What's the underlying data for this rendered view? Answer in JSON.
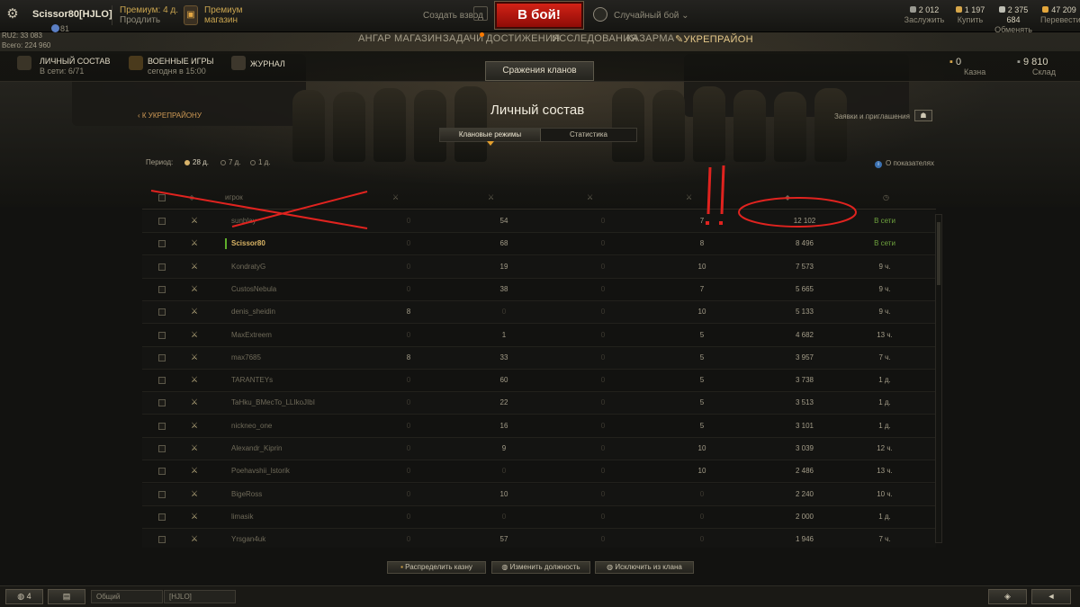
{
  "topbar": {
    "player_name": "Scissor80[HJLO]",
    "level": "81",
    "ratings": [
      "RU2: 33 083",
      "Всего: 224 960"
    ],
    "premium_label": "Премиум: 4 д.",
    "premium_extend": "Продлить",
    "shop_line1": "Премиум",
    "shop_line2": "магазин",
    "create_platoon": "Создать взвод",
    "battle_button": "В бой!",
    "battle_mode": "Случайный бой",
    "resources": [
      {
        "value": "2 012",
        "label": "Заслужить",
        "color": "#9a9a92"
      },
      {
        "value": "1 197",
        "label": "Купить",
        "color": "#d6a64a"
      },
      {
        "value": "2 375 684",
        "label": "Обменять",
        "color": "#bdbdb3"
      },
      {
        "value": "47 209",
        "label": "Перевести",
        "color": "#e3a63c"
      }
    ]
  },
  "nav": {
    "items": [
      "АНГАР",
      "МАГАЗИН",
      "ЗАДАЧИ",
      "ДОСТИЖЕНИЯ",
      "ИССЛЕДОВАНИЯ",
      "КАЗАРМА",
      "УКРЕПРАЙОН"
    ],
    "active": "УКРЕПРАЙОН"
  },
  "subnav": {
    "personnel_title": "ЛИЧНЫЙ СОСТАВ",
    "personnel_sub": "В сети: 6/71",
    "wargames_title": "ВОЕННЫЕ ИГРЫ",
    "wargames_sub": "сегодня в 15:00",
    "journal_title": "ЖУРНАЛ",
    "clan_battles": "Сражения кланов",
    "treasury_value": "0",
    "treasury_label": "Казна",
    "warehouse_value": "9 810",
    "warehouse_label": "Склад"
  },
  "page": {
    "back_link": "К УКРЕПРАЙОНУ",
    "title": "Личный состав",
    "tabs": [
      "Клановые режимы",
      "Статистика"
    ],
    "applications": "Заявки и приглашения",
    "period_label": "Период:",
    "periods": [
      "28 д.",
      "7 д.",
      "1 д."
    ],
    "period_selected": "28 д.",
    "info_link": "О показателях"
  },
  "table": {
    "header_player": "игрок",
    "rows": [
      {
        "name": "sunblay",
        "c1": "0",
        "c2": "54",
        "c3": "0",
        "c4": "7",
        "c5": "12 102",
        "status": "В сети",
        "online": true,
        "rank": "⚔",
        "me": false
      },
      {
        "name": "Scissor80",
        "c1": "0",
        "c2": "68",
        "c3": "0",
        "c4": "8",
        "c5": "8 496",
        "status": "В сети",
        "online": true,
        "rank": "⚔",
        "me": true
      },
      {
        "name": "KondratyG",
        "c1": "0",
        "c2": "19",
        "c3": "0",
        "c4": "10",
        "c5": "7 573",
        "status": "9 ч.",
        "online": false,
        "rank": "⚔",
        "me": false
      },
      {
        "name": "CustosNebula",
        "c1": "0",
        "c2": "38",
        "c3": "0",
        "c4": "7",
        "c5": "5 665",
        "status": "9 ч.",
        "online": false,
        "rank": "⚔",
        "me": false
      },
      {
        "name": "denis_sheidin",
        "c1": "8",
        "c2": "0",
        "c3": "0",
        "c4": "10",
        "c5": "5 133",
        "status": "9 ч.",
        "online": false,
        "rank": "⚔",
        "me": false
      },
      {
        "name": "MaxExtreem",
        "c1": "0",
        "c2": "1",
        "c3": "0",
        "c4": "5",
        "c5": "4 682",
        "status": "13 ч.",
        "online": false,
        "rank": "⚔",
        "me": false
      },
      {
        "name": "max7685",
        "c1": "8",
        "c2": "33",
        "c3": "0",
        "c4": "5",
        "c5": "3 957",
        "status": "7 ч.",
        "online": false,
        "rank": "⚔",
        "me": false
      },
      {
        "name": "TARANTEYs",
        "c1": "0",
        "c2": "60",
        "c3": "0",
        "c4": "5",
        "c5": "3 738",
        "status": "1 д.",
        "online": false,
        "rank": "⚔",
        "me": false
      },
      {
        "name": "TaHku_BMecTo_LLIkoJIbI",
        "c1": "0",
        "c2": "22",
        "c3": "0",
        "c4": "5",
        "c5": "3 513",
        "status": "1 д.",
        "online": false,
        "rank": "⚔",
        "me": false
      },
      {
        "name": "nickneo_one",
        "c1": "0",
        "c2": "16",
        "c3": "0",
        "c4": "5",
        "c5": "3 101",
        "status": "1 д.",
        "online": false,
        "rank": "⚔",
        "me": false
      },
      {
        "name": "Alexandr_Kiprin",
        "c1": "0",
        "c2": "9",
        "c3": "0",
        "c4": "10",
        "c5": "3 039",
        "status": "12 ч.",
        "online": false,
        "rank": "⚔",
        "me": false
      },
      {
        "name": "Poehavshii_Istorik",
        "c1": "0",
        "c2": "0",
        "c3": "0",
        "c4": "10",
        "c5": "2 486",
        "status": "13 ч.",
        "online": false,
        "rank": "⚔",
        "me": false
      },
      {
        "name": "BigeRoss",
        "c1": "0",
        "c2": "10",
        "c3": "0",
        "c4": "0",
        "c5": "2 240",
        "status": "10 ч.",
        "online": false,
        "rank": "⚔",
        "me": false
      },
      {
        "name": "limasik",
        "c1": "0",
        "c2": "0",
        "c3": "0",
        "c4": "0",
        "c5": "2 000",
        "status": "1 д.",
        "online": false,
        "rank": "⚔",
        "me": false
      },
      {
        "name": "Yrsgan4uk",
        "c1": "0",
        "c2": "57",
        "c3": "0",
        "c4": "0",
        "c5": "1 946",
        "status": "7 ч.",
        "online": false,
        "rank": "⚔",
        "me": false
      }
    ]
  },
  "actions": {
    "distribute": "Распределить казну",
    "change_position": "Изменить должность",
    "exclude": "Исключить из клана"
  },
  "footer": {
    "online_count": "4",
    "channel_general": "Общий",
    "channel_clan": "[HJLO]"
  },
  "annotation_color": "#e0231f"
}
